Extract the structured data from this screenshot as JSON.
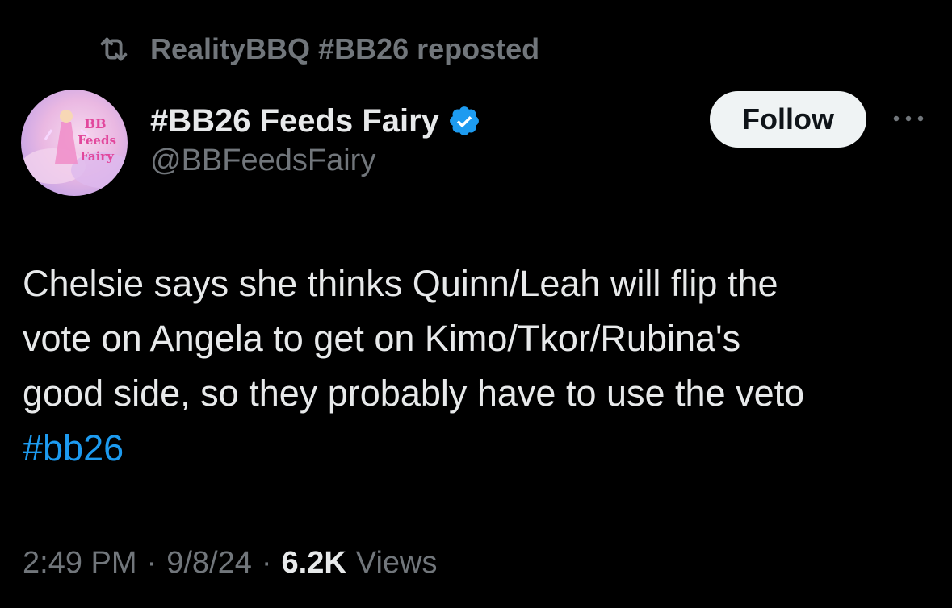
{
  "repost": {
    "text": "RealityBBQ #BB26 reposted",
    "icon": "repost-icon"
  },
  "author": {
    "display_name": "#BB26 Feeds Fairy",
    "handle": "@BBFeedsFairy",
    "verified_icon": "verified-badge-icon",
    "verified_color": "#1d9bf0",
    "avatar_text_line1": "BB",
    "avatar_text_line2": "Feeds",
    "avatar_text_line3": "Fairy"
  },
  "actions": {
    "follow_label": "Follow",
    "more_icon": "more-options-icon"
  },
  "tweet": {
    "line1": "Chelsie says she thinks Quinn/Leah will flip the",
    "line2": "vote on Angela to get on Kimo/Tkor/Rubina's",
    "line3": "good side, so they probably have to use the veto",
    "hashtag": "#bb26",
    "hashtag_color": "#1d9bf0"
  },
  "meta": {
    "time": "2:49 PM",
    "separator": "·",
    "date": "9/8/24",
    "views_count": "6.2K",
    "views_label": "Views"
  }
}
